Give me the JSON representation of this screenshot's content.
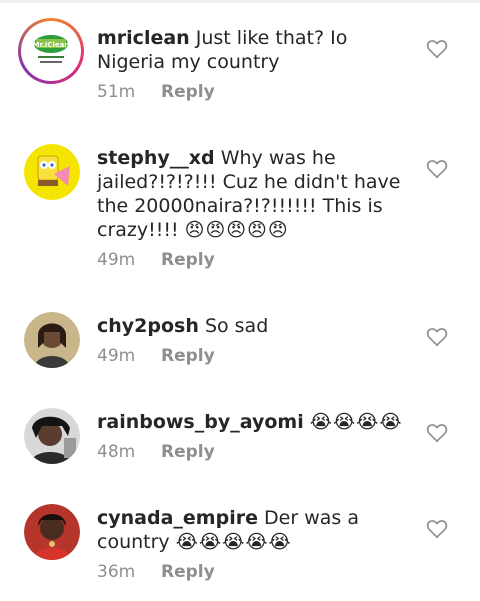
{
  "comments": [
    {
      "username": "mriclean",
      "text": "Just like that? Io Nigeria my country",
      "emoji": "",
      "time": "51m",
      "reply_label": "Reply"
    },
    {
      "username": "stephy__xd",
      "text": "Why was he jailed?!?!?!!! Cuz he didn't have the 20000naira?!?!!!!!! This is crazy!!!!",
      "emoji": "😠😠😠😠😠",
      "time": "49m",
      "reply_label": "Reply"
    },
    {
      "username": "chy2posh",
      "text": "So sad",
      "emoji": "",
      "time": "49m",
      "reply_label": "Reply"
    },
    {
      "username": "rainbows_by_ayomi",
      "text": "",
      "emoji": "😭😭😭😭",
      "time": "48m",
      "reply_label": "Reply"
    },
    {
      "username": "cynada_empire",
      "text": "Der was a country",
      "emoji": "😭😭😭😭😭",
      "time": "36m",
      "reply_label": "Reply"
    }
  ],
  "avatar_logo_text": "Mr.IClean"
}
